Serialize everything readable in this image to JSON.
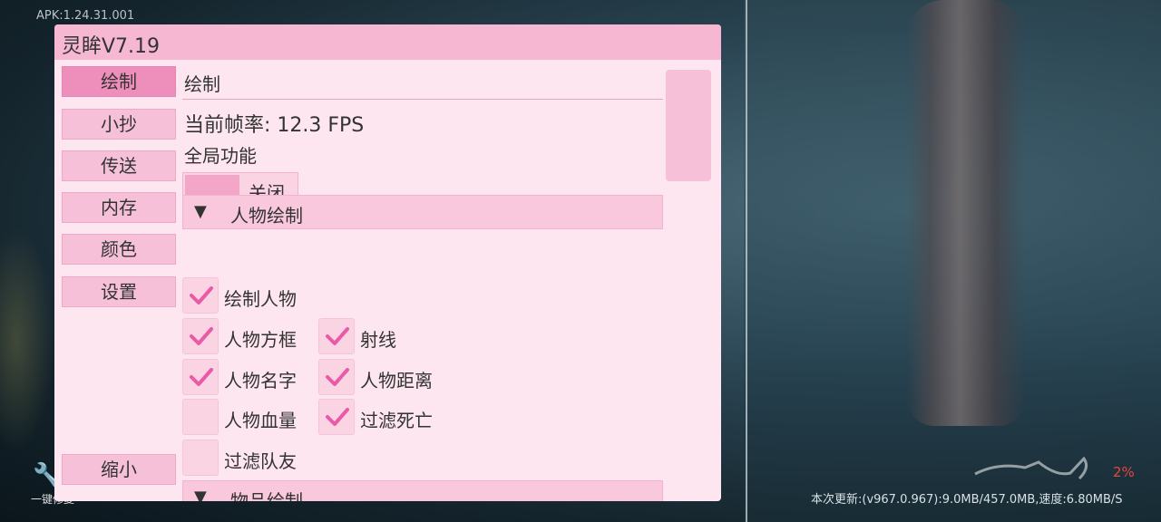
{
  "overlay": {
    "apk_version": "APK:1.24.31.001",
    "tool_label": "一键修复",
    "percent": "2%",
    "update_status": "本次更新:(v967.0.967):9.0MB/457.0MB,速度:6.80MB/S"
  },
  "panel": {
    "title": "灵眸V7.19",
    "sidebar": [
      {
        "label": "绘制",
        "active": true
      },
      {
        "label": "小抄"
      },
      {
        "label": "传送"
      },
      {
        "label": "内存"
      },
      {
        "label": "颜色"
      },
      {
        "label": "设置"
      }
    ],
    "minimize_label": "缩小",
    "section_title": "绘制",
    "fps_text": "当前帧率: 12.3 FPS",
    "global_label": "全局功能",
    "toggle_label": "关闭",
    "groups": {
      "character": {
        "arrow": "▼",
        "label": "人物绘制"
      },
      "items": {
        "arrow": "▼",
        "label": "物品绘制"
      }
    },
    "checkboxes": {
      "draw_player": {
        "label": "绘制人物",
        "checked": true
      },
      "player_box": {
        "label": "人物方框",
        "checked": true
      },
      "ray": {
        "label": "射线",
        "checked": true
      },
      "player_name": {
        "label": "人物名字",
        "checked": true
      },
      "player_distance": {
        "label": "人物距离",
        "checked": true
      },
      "player_health": {
        "label": "人物血量",
        "checked": false
      },
      "filter_dead": {
        "label": "过滤死亡",
        "checked": true
      },
      "filter_teammates": {
        "label": "过滤队友",
        "checked": false
      }
    },
    "colors": {
      "accent": "#e95aa7",
      "panel_bg": "#fde6ef",
      "titlebar": "#f6b7d2"
    }
  }
}
